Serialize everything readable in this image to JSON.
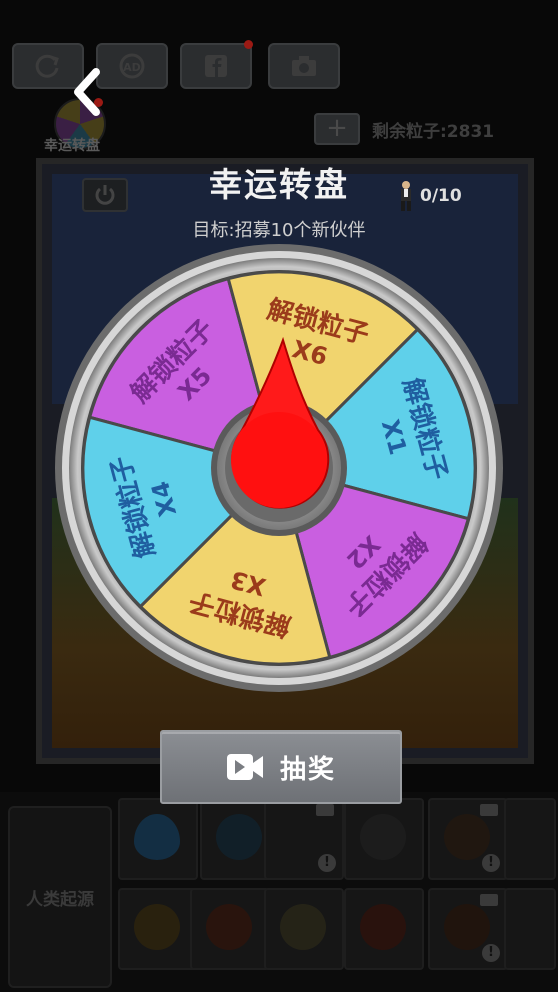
{
  "header": {
    "title": "幸运转盘",
    "goal_text": "目标:招募10个新伙伴",
    "progress": "0/10"
  },
  "background": {
    "wheel_label": "幸运转盘",
    "remaining_particles": "剩余粒子:2831",
    "origin_label": "人类起源"
  },
  "wheel": {
    "segments": [
      {
        "line1": "解锁粒子",
        "line2": "X5",
        "color": "#c95fe0"
      },
      {
        "line1": "解锁粒子",
        "line2": "X6",
        "color": "#f1d46e"
      },
      {
        "line1": "解锁粒子",
        "line2": "X1",
        "color": "#5fd0ea"
      },
      {
        "line1": "解锁粒子",
        "line2": "X2",
        "color": "#c95fe0"
      },
      {
        "line1": "解锁粒子",
        "line2": "X3",
        "color": "#f1d46e"
      },
      {
        "line1": "解锁粒子",
        "line2": "X4",
        "color": "#5fd0ea"
      }
    ]
  },
  "draw_button": {
    "label": "抽奖",
    "icon": "video-camera-icon"
  },
  "colors": {
    "text_purple": "#7a2a92",
    "text_gold": "#9b3b1b",
    "text_blue": "#1f5ea0",
    "pointer": "#e60000"
  }
}
